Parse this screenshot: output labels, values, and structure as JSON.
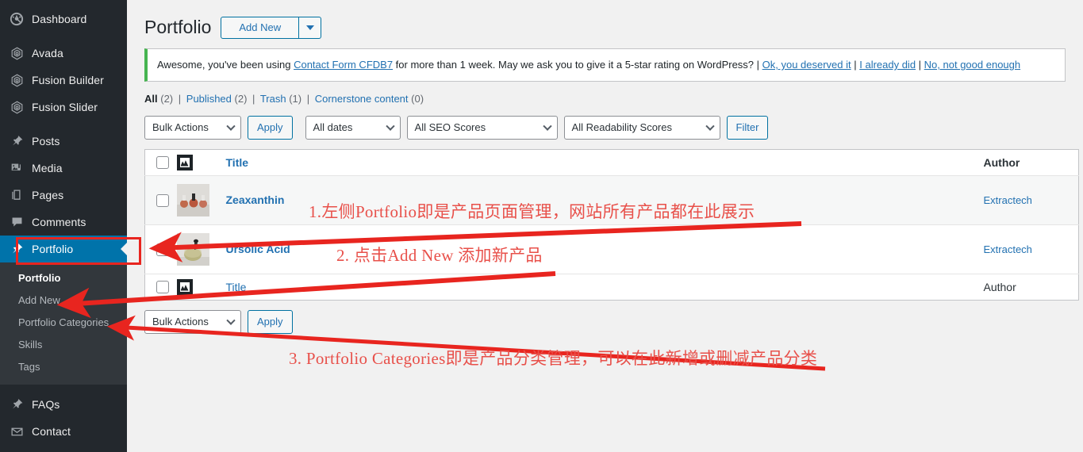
{
  "sidebar": {
    "items": [
      {
        "label": "Dashboard",
        "icon": "dashboard-icon"
      },
      {
        "label": "Avada",
        "icon": "avada-icon"
      },
      {
        "label": "Fusion Builder",
        "icon": "fusion-builder-icon"
      },
      {
        "label": "Fusion Slider",
        "icon": "fusion-slider-icon"
      },
      {
        "label": "Posts",
        "icon": "pin-icon"
      },
      {
        "label": "Media",
        "icon": "media-icon"
      },
      {
        "label": "Pages",
        "icon": "pages-icon"
      },
      {
        "label": "Comments",
        "icon": "comments-icon"
      },
      {
        "label": "Portfolio",
        "icon": "pin-icon",
        "current": true
      },
      {
        "label": "FAQs",
        "icon": "pin-icon"
      },
      {
        "label": "Contact",
        "icon": "mail-icon"
      }
    ],
    "submenu": [
      {
        "label": "Portfolio",
        "current": true
      },
      {
        "label": "Add New"
      },
      {
        "label": "Portfolio Categories"
      },
      {
        "label": "Skills"
      },
      {
        "label": "Tags"
      }
    ]
  },
  "header": {
    "title": "Portfolio",
    "add_new_label": "Add New",
    "add_new_caret": "chevron-down-icon"
  },
  "notice": {
    "text_before": "Awesome, you've been using ",
    "link_plugin": "Contact Form CFDB7",
    "text_middle": " for more than 1 week. May we ask you to give it a 5-star rating on WordPress? | ",
    "link_ok": "Ok, you deserved it",
    "link_already": "I already did",
    "link_no": "No, not good enough",
    "accent_color": "#46b450"
  },
  "filters": {
    "all_label": "All",
    "all_count": "(2)",
    "published_label": "Published",
    "published_count": "(2)",
    "trash_label": "Trash",
    "trash_count": "(1)",
    "cornerstone_label": "Cornerstone content",
    "cornerstone_count": "(0)",
    "separator": "|"
  },
  "toolbar_top": {
    "bulk_actions": "Bulk Actions",
    "apply": "Apply",
    "all_dates": "All dates",
    "all_seo_scores": "All SEO Scores",
    "all_readability_scores": "All Readability Scores",
    "filter": "Filter"
  },
  "toolbar_bottom": {
    "bulk_actions": "Bulk Actions",
    "apply": "Apply"
  },
  "table": {
    "columns": {
      "title": "Title",
      "author": "Author",
      "image": "featured-image-icon"
    },
    "rows": [
      {
        "title": "Zeaxanthin",
        "author": "Extractech"
      },
      {
        "title": "Ursolic Acid",
        "author": "Extractech"
      }
    ]
  },
  "annotations": [
    {
      "id": 1,
      "text": "1.左侧Portfolio即是产品页面管理，网站所有产品都在此展示"
    },
    {
      "id": 2,
      "text": "2. 点击Add New 添加新产品"
    },
    {
      "id": 3,
      "text": "3. Portfolio Categories即是产品分类管理，可以在此新增或删减产品分类"
    }
  ],
  "annotation_color": "#e8504a",
  "highlight_color": "#e8251f"
}
